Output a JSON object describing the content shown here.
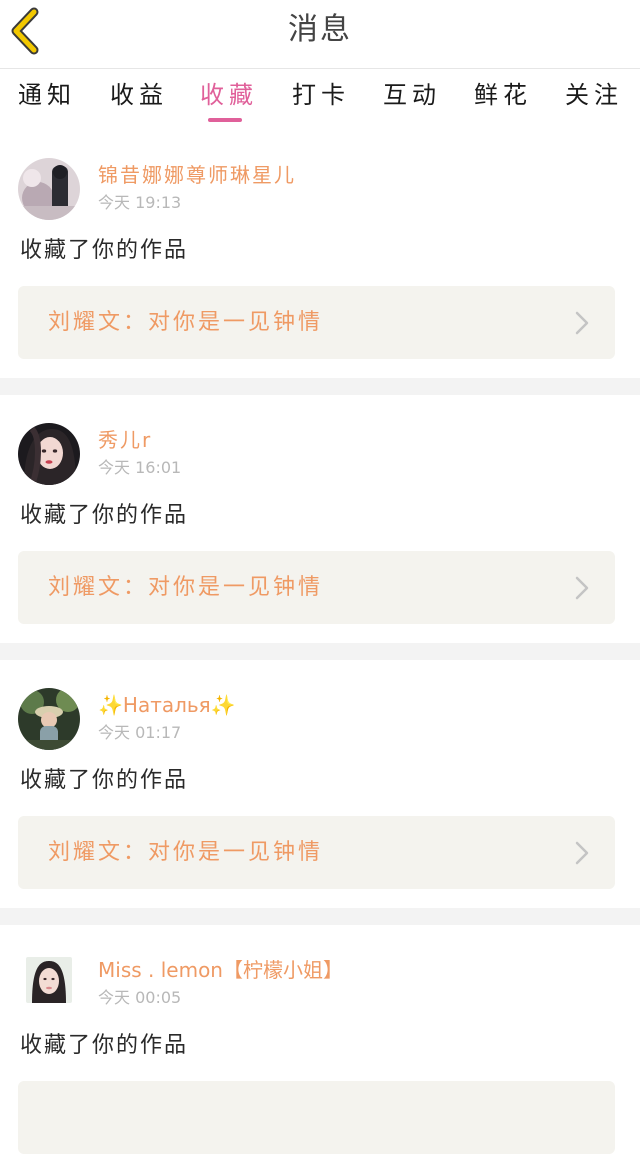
{
  "header": {
    "title": "消息",
    "back_icon": "chevron-left-icon"
  },
  "tabs": [
    {
      "label": "通知"
    },
    {
      "label": "收益"
    },
    {
      "label": "收藏",
      "active": true
    },
    {
      "label": "打卡"
    },
    {
      "label": "互动"
    },
    {
      "label": "鲜花"
    },
    {
      "label": "关注"
    }
  ],
  "colors": {
    "accent": "#e0609a",
    "username": "#ef9a64",
    "work_title": "#ef9a64",
    "work_box_bg": "#f4f3ee",
    "back_icon": "#f2c800"
  },
  "notifications": [
    {
      "username": "锦昔娜娜尊师琳星儿",
      "time": "今天 19:13",
      "action": "收藏了你的作品",
      "work_title": "刘耀文：对你是一见钟情"
    },
    {
      "username": "秀儿r",
      "time": "今天 16:01",
      "action": "收藏了你的作品",
      "work_title": "刘耀文：对你是一见钟情"
    },
    {
      "username": "✨Наталья✨",
      "time": "今天 01:17",
      "action": "收藏了你的作品",
      "work_title": "刘耀文：对你是一见钟情"
    },
    {
      "username": "Miss . lemon【柠檬小姐】",
      "time": "今天 00:05",
      "action": "收藏了你的作品",
      "work_title": ""
    }
  ]
}
